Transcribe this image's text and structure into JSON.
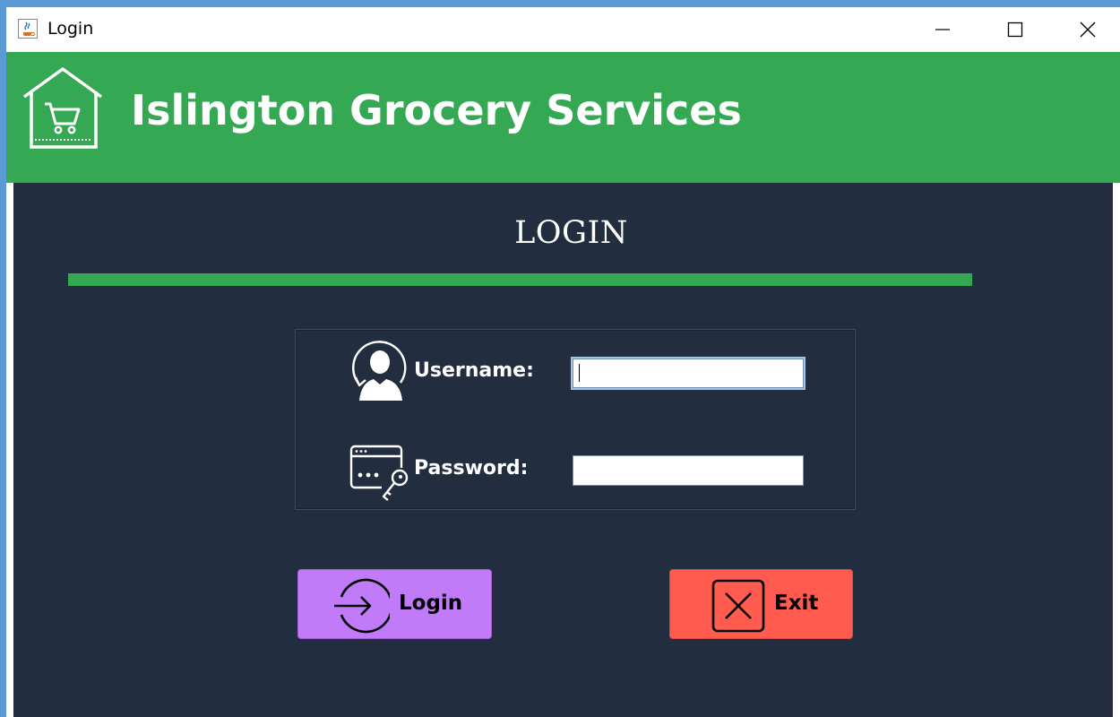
{
  "window": {
    "title": "Login",
    "controls": [
      "minimize-icon",
      "maximize-icon",
      "close-icon"
    ]
  },
  "header": {
    "logo_icon": "grocery-cart-house-icon",
    "title": "Islington Grocery Services"
  },
  "form": {
    "heading": "LOGIN",
    "username": {
      "icon": "user-icon",
      "label": "Username:",
      "value": ""
    },
    "password": {
      "icon": "password-key-icon",
      "label": "Password:",
      "value": ""
    }
  },
  "buttons": {
    "login": {
      "label": "Login",
      "icon": "sign-in-icon"
    },
    "exit": {
      "label": "Exit",
      "icon": "close-box-icon"
    }
  },
  "colors": {
    "accent_green": "#35a853",
    "panel_bg": "#222e3f",
    "login_button": "#c17bf9",
    "exit_button": "#ff5c4f",
    "text_white": "#ffffff"
  }
}
